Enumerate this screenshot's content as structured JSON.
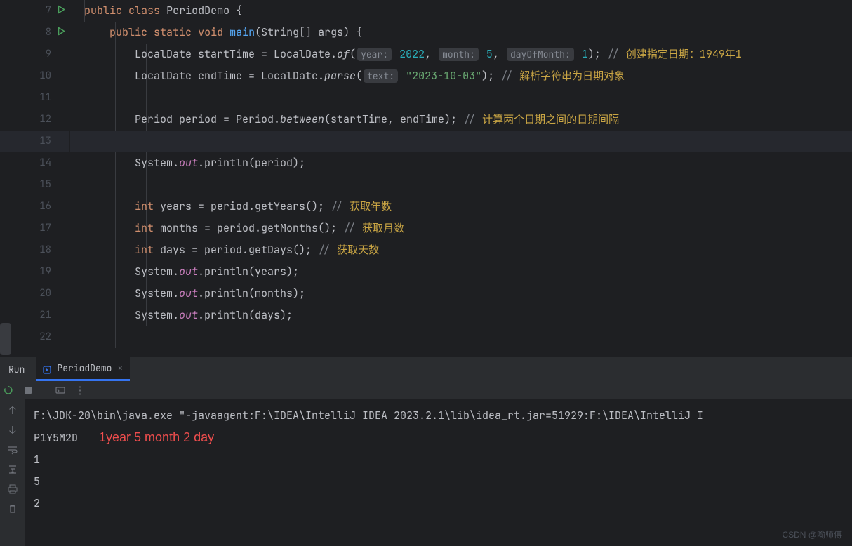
{
  "lines": [
    {
      "n": 7,
      "run": true
    },
    {
      "n": 8,
      "run": true
    },
    {
      "n": 9
    },
    {
      "n": 10
    },
    {
      "n": 11
    },
    {
      "n": 12
    },
    {
      "n": 13,
      "active": true
    },
    {
      "n": 14
    },
    {
      "n": 15
    },
    {
      "n": 16
    },
    {
      "n": 17
    },
    {
      "n": 18
    },
    {
      "n": 19
    },
    {
      "n": 20
    },
    {
      "n": 21
    },
    {
      "n": 22
    }
  ],
  "code": {
    "l7": {
      "kw1": "public",
      "kw2": "class",
      "cls": "PeriodDemo",
      "brace": " {"
    },
    "l8": {
      "kw1": "public",
      "kw2": "static",
      "kw3": "void",
      "main": "main",
      "args": "(String[] args) {"
    },
    "l9": {
      "t1": "LocalDate startTime = LocalDate.",
      "m": "of",
      "p": "(",
      "h1": "year:",
      "v1": " 2022",
      "c1": ", ",
      "h2": "month:",
      "v2": " 5",
      "c2": ", ",
      "h3": "dayOfMonth:",
      "v3": " 1",
      "p2": "); ",
      "cmt": "// ",
      "cmtcn": "创建指定日期：1949年1"
    },
    "l10": {
      "t1": "LocalDate endTime = LocalDate.",
      "m": "parse",
      "p": "(",
      "h1": "text:",
      "s": " \"2023-10-03\"",
      "p2": "); ",
      "cmt": "// ",
      "cmtcn": "解析字符串为日期对象"
    },
    "l12": {
      "t1": "Period period = Period.",
      "m": "between",
      "args": "(startTime, endTime); ",
      "cmt": "// ",
      "cmtcn": "计算两个日期之间的日期间隔"
    },
    "l14": {
      "t1": "System.",
      "out": "out",
      "p": ".println(period);"
    },
    "l16": {
      "kw": "int",
      "t": " years = period.getYears(); ",
      "cmt": "// ",
      "cmtcn": "获取年数"
    },
    "l17": {
      "kw": "int",
      "t": " months = period.getMonths(); ",
      "cmt": "// ",
      "cmtcn": "获取月数"
    },
    "l18": {
      "kw": "int",
      "t": " days = period.getDays(); ",
      "cmt": "// ",
      "cmtcn": "获取天数"
    },
    "l19": {
      "t1": "System.",
      "out": "out",
      "p": ".println(years);"
    },
    "l20": {
      "t1": "System.",
      "out": "out",
      "p": ".println(months);"
    },
    "l21": {
      "t1": "System.",
      "out": "out",
      "p": ".println(days);"
    }
  },
  "run": {
    "panel_title": "Run",
    "tab_label": "PeriodDemo",
    "tab_close": "×"
  },
  "console": {
    "line1": "F:\\JDK-20\\bin\\java.exe \"-javaagent:F:\\IDEA\\IntelliJ IDEA 2023.2.1\\lib\\idea_rt.jar=51929:F:\\IDEA\\IntelliJ I",
    "line2": "P1Y5M2D",
    "annotation": "1year 5 month 2 day",
    "line3": "1",
    "line4": "5",
    "line5": "2"
  },
  "watermark": "CSDN @喻师傅"
}
